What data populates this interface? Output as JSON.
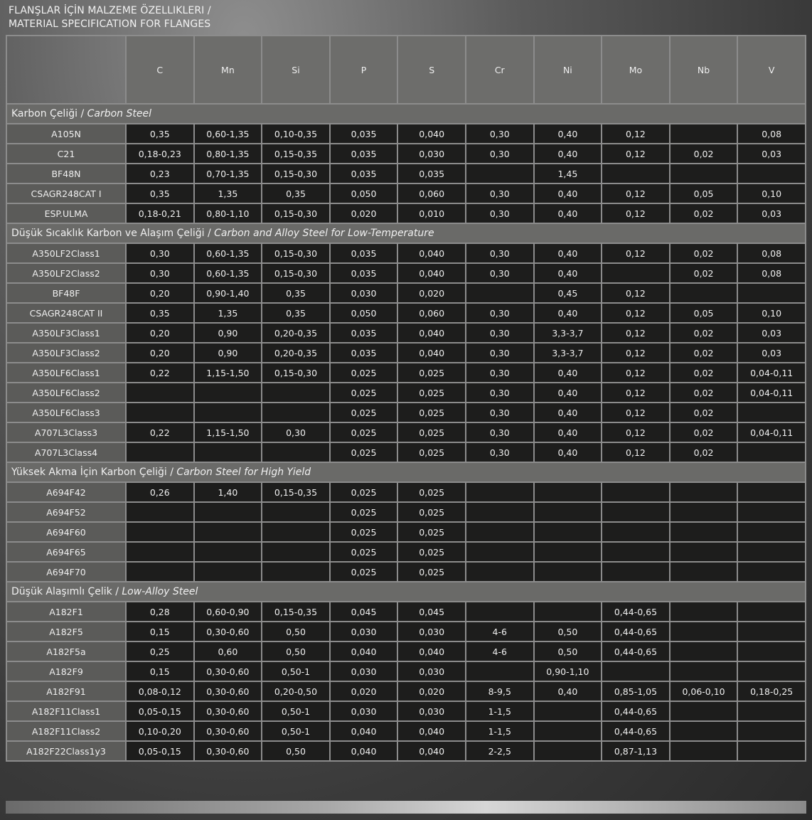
{
  "title_tr": "FLANŞLAR İÇİN MALZEME ÖZELLIKLERI  /",
  "title_en": "MATERIAL SPECIFICATION FOR FLANGES",
  "columns": [
    "C",
    "Mn",
    "Si",
    "P",
    "S",
    "Cr",
    "Ni",
    "Mo",
    "Nb",
    "V"
  ],
  "sections": [
    {
      "title_tr": "Karbon Çeliği / ",
      "title_en": "Carbon Steel",
      "rows": [
        {
          "grade": "A105N",
          "values": [
            "0,35",
            "0,60-1,35",
            "0,10-0,35",
            "0,035",
            "0,040",
            "0,30",
            "0,40",
            "0,12",
            "",
            "0,08"
          ]
        },
        {
          "grade": "C21",
          "values": [
            "0,18-0,23",
            "0,80-1,35",
            "0,15-0,35",
            "0,035",
            "0,030",
            "0,30",
            "0,40",
            "0,12",
            "0,02",
            "0,03"
          ]
        },
        {
          "grade": "BF48N",
          "values": [
            "0,23",
            "0,70-1,35",
            "0,15-0,30",
            "0,035",
            "0,035",
            "",
            "1,45",
            "",
            "",
            ""
          ]
        },
        {
          "grade": "CSAGR248CAT I",
          "values": [
            "0,35",
            "1,35",
            "0,35",
            "0,050",
            "0,060",
            "0,30",
            "0,40",
            "0,12",
            "0,05",
            "0,10"
          ]
        },
        {
          "grade": "ESP.ULMA",
          "values": [
            "0,18-0,21",
            "0,80-1,10",
            "0,15-0,30",
            "0,020",
            "0,010",
            "0,30",
            "0,40",
            "0,12",
            "0,02",
            "0,03"
          ]
        }
      ]
    },
    {
      "title_tr": "Düşük Sıcaklık Karbon ve Alaşım Çeliği / ",
      "title_en": "Carbon and Alloy Steel for Low-Temperature",
      "rows": [
        {
          "grade": "A350LF2Class1",
          "values": [
            "0,30",
            "0,60-1,35",
            "0,15-0,30",
            "0,035",
            "0,040",
            "0,30",
            "0,40",
            "0,12",
            "0,02",
            "0,08"
          ]
        },
        {
          "grade": "A350LF2Class2",
          "values": [
            "0,30",
            "0,60-1,35",
            "0,15-0,30",
            "0,035",
            "0,040",
            "0,30",
            "0,40",
            "",
            "0,02",
            "0,08"
          ]
        },
        {
          "grade": "BF48F",
          "values": [
            "0,20",
            "0,90-1,40",
            "0,35",
            "0,030",
            "0,020",
            "",
            "0,45",
            "0,12",
            "",
            ""
          ]
        },
        {
          "grade": "CSAGR248CAT II",
          "values": [
            "0,35",
            "1,35",
            "0,35",
            "0,050",
            "0,060",
            "0,30",
            "0,40",
            "0,12",
            "0,05",
            "0,10"
          ]
        },
        {
          "grade": "A350LF3Class1",
          "values": [
            "0,20",
            "0,90",
            "0,20-0,35",
            "0,035",
            "0,040",
            "0,30",
            "3,3-3,7",
            "0,12",
            "0,02",
            "0,03"
          ]
        },
        {
          "grade": "A350LF3Class2",
          "values": [
            "0,20",
            "0,90",
            "0,20-0,35",
            "0,035",
            "0,040",
            "0,30",
            "3,3-3,7",
            "0,12",
            "0,02",
            "0,03"
          ]
        },
        {
          "grade": "A350LF6Class1",
          "values": [
            "0,22",
            "1,15-1,50",
            "0,15-0,30",
            "0,025",
            "0,025",
            "0,30",
            "0,40",
            "0,12",
            "0,02",
            "0,04-0,11"
          ]
        },
        {
          "grade": "A350LF6Class2",
          "values": [
            "",
            "",
            "",
            "0,025",
            "0,025",
            "0,30",
            "0,40",
            "0,12",
            "0,02",
            "0,04-0,11"
          ]
        },
        {
          "grade": "A350LF6Class3",
          "values": [
            "",
            "",
            "",
            "0,025",
            "0,025",
            "0,30",
            "0,40",
            "0,12",
            "0,02",
            ""
          ]
        },
        {
          "grade": "A707L3Class3",
          "values": [
            "0,22",
            "1,15-1,50",
            "0,30",
            "0,025",
            "0,025",
            "0,30",
            "0,40",
            "0,12",
            "0,02",
            "0,04-0,11"
          ]
        },
        {
          "grade": "A707L3Class4",
          "values": [
            "",
            "",
            "",
            "0,025",
            "0,025",
            "0,30",
            "0,40",
            "0,12",
            "0,02",
            ""
          ]
        }
      ]
    },
    {
      "title_tr": "Yüksek Akma İçin Karbon Çeliği / ",
      "title_en": "Carbon Steel for High Yield",
      "rows": [
        {
          "grade": "A694F42",
          "values": [
            "0,26",
            "1,40",
            "0,15-0,35",
            "0,025",
            "0,025",
            "",
            "",
            "",
            "",
            ""
          ]
        },
        {
          "grade": "A694F52",
          "values": [
            "",
            "",
            "",
            "0,025",
            "0,025",
            "",
            "",
            "",
            "",
            ""
          ]
        },
        {
          "grade": "A694F60",
          "values": [
            "",
            "",
            "",
            "0,025",
            "0,025",
            "",
            "",
            "",
            "",
            ""
          ]
        },
        {
          "grade": "A694F65",
          "values": [
            "",
            "",
            "",
            "0,025",
            "0,025",
            "",
            "",
            "",
            "",
            ""
          ]
        },
        {
          "grade": "A694F70",
          "values": [
            "",
            "",
            "",
            "0,025",
            "0,025",
            "",
            "",
            "",
            "",
            ""
          ]
        }
      ]
    },
    {
      "title_tr": "Düşük Alaşımlı Çelik / ",
      "title_en": "Low-Alloy Steel",
      "rows": [
        {
          "grade": "A182F1",
          "values": [
            "0,28",
            "0,60-0,90",
            "0,15-0,35",
            "0,045",
            "0,045",
            "",
            "",
            "0,44-0,65",
            "",
            ""
          ]
        },
        {
          "grade": "A182F5",
          "values": [
            "0,15",
            "0,30-0,60",
            "0,50",
            "0,030",
            "0,030",
            "4-6",
            "0,50",
            "0,44-0,65",
            "",
            ""
          ]
        },
        {
          "grade": "A182F5a",
          "values": [
            "0,25",
            "0,60",
            "0,50",
            "0,040",
            "0,040",
            "4-6",
            "0,50",
            "0,44-0,65",
            "",
            ""
          ]
        },
        {
          "grade": "A182F9",
          "values": [
            "0,15",
            "0,30-0,60",
            "0,50-1",
            "0,030",
            "0,030",
            "",
            "0,90-1,10",
            "",
            "",
            ""
          ]
        },
        {
          "grade": "A182F91",
          "values": [
            "0,08-0,12",
            "0,30-0,60",
            "0,20-0,50",
            "0,020",
            "0,020",
            "8-9,5",
            "0,40",
            "0,85-1,05",
            "0,06-0,10",
            "0,18-0,25"
          ]
        },
        {
          "grade": "A182F11Class1",
          "values": [
            "0,05-0,15",
            "0,30-0,60",
            "0,50-1",
            "0,030",
            "0,030",
            "1-1,5",
            "",
            "0,44-0,65",
            "",
            ""
          ]
        },
        {
          "grade": "A182F11Class2",
          "values": [
            "0,10-0,20",
            "0,30-0,60",
            "0,50-1",
            "0,040",
            "0,040",
            "1-1,5",
            "",
            "0,44-0,65",
            "",
            ""
          ]
        },
        {
          "grade": "A182F22Class1y3",
          "values": [
            "0,05-0,15",
            "0,30-0,60",
            "0,50",
            "0,040",
            "0,040",
            "2-2,5",
            "",
            "0,87-1,13",
            "",
            ""
          ]
        }
      ]
    }
  ]
}
